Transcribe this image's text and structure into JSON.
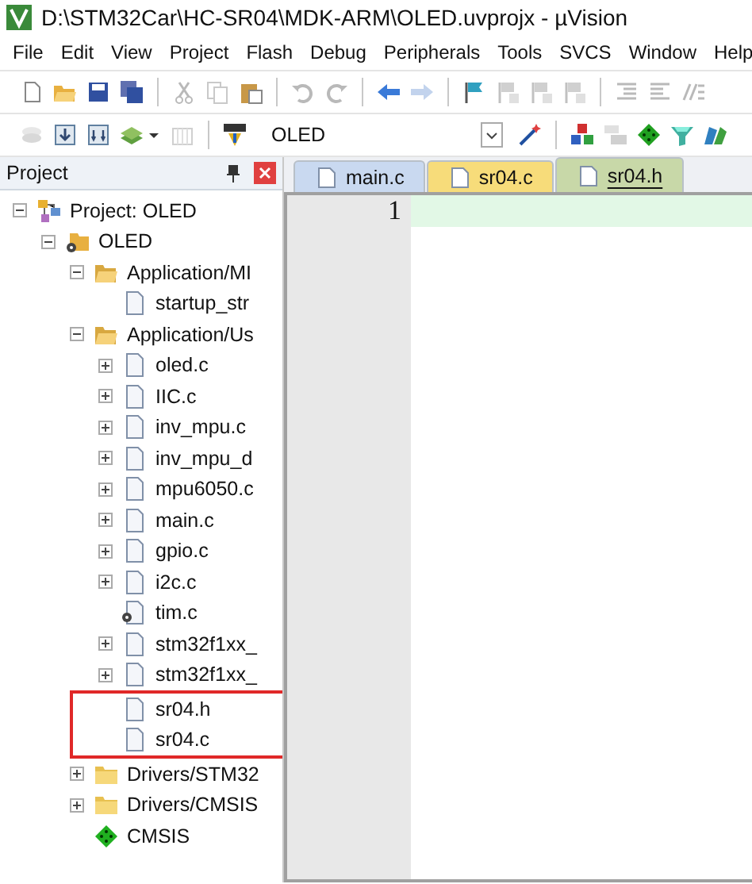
{
  "window": {
    "title": "D:\\STM32Car\\HC-SR04\\MDK-ARM\\OLED.uvprojx - µVision"
  },
  "menu": [
    "File",
    "Edit",
    "View",
    "Project",
    "Flash",
    "Debug",
    "Peripherals",
    "Tools",
    "SVCS",
    "Window",
    "Help"
  ],
  "toolbar_1": [
    {
      "kind": "new-file",
      "disabled": false
    },
    {
      "kind": "open-folder",
      "disabled": false
    },
    {
      "kind": "save",
      "disabled": false
    },
    {
      "kind": "save-all",
      "disabled": false
    },
    {
      "kind": "separator"
    },
    {
      "kind": "cut",
      "disabled": true
    },
    {
      "kind": "copy",
      "disabled": true
    },
    {
      "kind": "paste",
      "disabled": false
    },
    {
      "kind": "separator"
    },
    {
      "kind": "undo",
      "disabled": true
    },
    {
      "kind": "redo",
      "disabled": true
    },
    {
      "kind": "separator"
    },
    {
      "kind": "back",
      "disabled": false
    },
    {
      "kind": "forward",
      "disabled": true
    },
    {
      "kind": "separator"
    },
    {
      "kind": "flag",
      "disabled": false
    },
    {
      "kind": "bookmark",
      "disabled": true
    },
    {
      "kind": "bookmark",
      "disabled": true
    },
    {
      "kind": "bookmark",
      "disabled": true
    },
    {
      "kind": "separator"
    },
    {
      "kind": "indent",
      "disabled": true
    },
    {
      "kind": "unindent",
      "disabled": true
    },
    {
      "kind": "comment",
      "disabled": true
    }
  ],
  "toolbar_2": [
    {
      "kind": "translate",
      "disabled": true
    },
    {
      "kind": "build",
      "disabled": false
    },
    {
      "kind": "rebuild",
      "disabled": false
    },
    {
      "kind": "batch",
      "disabled": false
    },
    {
      "kind": "caret",
      "disabled": false
    },
    {
      "kind": "stop",
      "disabled": true
    },
    {
      "kind": "separator"
    },
    {
      "kind": "load",
      "disabled": false
    }
  ],
  "target_select": {
    "value": "OLED"
  },
  "toolbar_3": [
    {
      "kind": "wand",
      "disabled": false
    },
    {
      "kind": "separator"
    },
    {
      "kind": "cubes",
      "disabled": false
    },
    {
      "kind": "stack",
      "disabled": true
    },
    {
      "kind": "diamond",
      "disabled": false
    },
    {
      "kind": "funnel",
      "disabled": false
    },
    {
      "kind": "books",
      "disabled": false
    }
  ],
  "project_panel": {
    "title": "Project",
    "tree": [
      {
        "label": "Project: OLED",
        "kind": "project",
        "toggle": true,
        "expanded": true,
        "children": [
          {
            "label": "OLED",
            "kind": "target",
            "toggle": true,
            "expanded": true,
            "children": [
              {
                "label": "Application/MI",
                "kind": "folder",
                "toggle": true,
                "expanded": true,
                "children": [
                  {
                    "label": "startup_str",
                    "kind": "file",
                    "toggle": false
                  }
                ]
              },
              {
                "label": "Application/Us",
                "kind": "folder",
                "toggle": true,
                "expanded": true,
                "children": [
                  {
                    "label": "oled.c",
                    "kind": "file",
                    "toggle": true,
                    "expanded": false
                  },
                  {
                    "label": "IIC.c",
                    "kind": "file",
                    "toggle": true,
                    "expanded": false
                  },
                  {
                    "label": "inv_mpu.c",
                    "kind": "file",
                    "toggle": true,
                    "expanded": false
                  },
                  {
                    "label": "inv_mpu_d",
                    "kind": "file",
                    "toggle": true,
                    "expanded": false
                  },
                  {
                    "label": "mpu6050.c",
                    "kind": "file",
                    "toggle": true,
                    "expanded": false
                  },
                  {
                    "label": "main.c",
                    "kind": "file",
                    "toggle": true,
                    "expanded": false
                  },
                  {
                    "label": "gpio.c",
                    "kind": "file",
                    "toggle": true,
                    "expanded": false
                  },
                  {
                    "label": "i2c.c",
                    "kind": "file",
                    "toggle": true,
                    "expanded": false
                  },
                  {
                    "label": "tim.c",
                    "kind": "gear-file",
                    "toggle": false
                  },
                  {
                    "label": "stm32f1xx_",
                    "kind": "file",
                    "toggle": true,
                    "expanded": false
                  },
                  {
                    "label": "stm32f1xx_",
                    "kind": "file",
                    "toggle": true,
                    "expanded": false
                  },
                  {
                    "label": "sr04.h",
                    "kind": "file",
                    "toggle": false,
                    "highlighted": true
                  },
                  {
                    "label": "sr04.c",
                    "kind": "file",
                    "toggle": false,
                    "highlighted": true
                  }
                ]
              },
              {
                "label": "Drivers/STM32",
                "kind": "folder-closed",
                "toggle": true,
                "expanded": false
              },
              {
                "label": "Drivers/CMSIS",
                "kind": "folder-closed",
                "toggle": true,
                "expanded": false
              },
              {
                "label": "CMSIS",
                "kind": "component",
                "toggle": false
              }
            ]
          }
        ]
      }
    ]
  },
  "editor": {
    "tabs": [
      {
        "label": "main.c",
        "selected": false,
        "color": "#c9d9f0"
      },
      {
        "label": "sr04.c",
        "selected": false,
        "color": "#f7dc7a"
      },
      {
        "label": "sr04.h",
        "selected": true,
        "color": "#c8d8a8"
      }
    ],
    "lines": [
      {
        "number": "1",
        "current": true
      }
    ]
  }
}
